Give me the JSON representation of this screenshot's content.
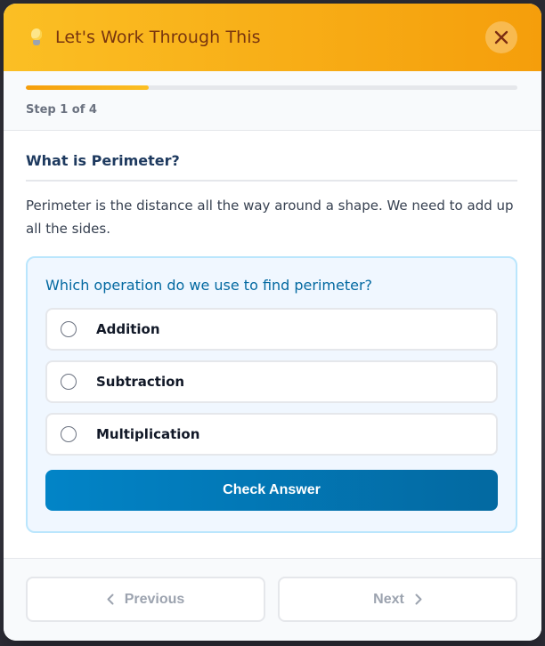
{
  "header": {
    "icon": "lightbulb-icon",
    "title": "Let's Work Through This",
    "close_icon": "close-icon"
  },
  "progress": {
    "current_step": 1,
    "total_steps": 4,
    "label": "Step 1 of 4",
    "fraction": 0.25
  },
  "step": {
    "title": "What is Perimeter?",
    "explanation": "Perimeter is the distance all the way around a shape. We need to add up all the sides."
  },
  "question": {
    "prompt": "Which operation do we use to find perimeter?",
    "options": [
      {
        "label": "Addition"
      },
      {
        "label": "Subtraction"
      },
      {
        "label": "Multiplication"
      }
    ],
    "check_label": "Check Answer"
  },
  "footer": {
    "previous_label": "Previous",
    "next_label": "Next"
  },
  "colors": {
    "header_start": "#fbbf24",
    "header_end": "#f59e0b",
    "accent_blue": "#0369a1",
    "disabled_text": "#9ca3af"
  }
}
